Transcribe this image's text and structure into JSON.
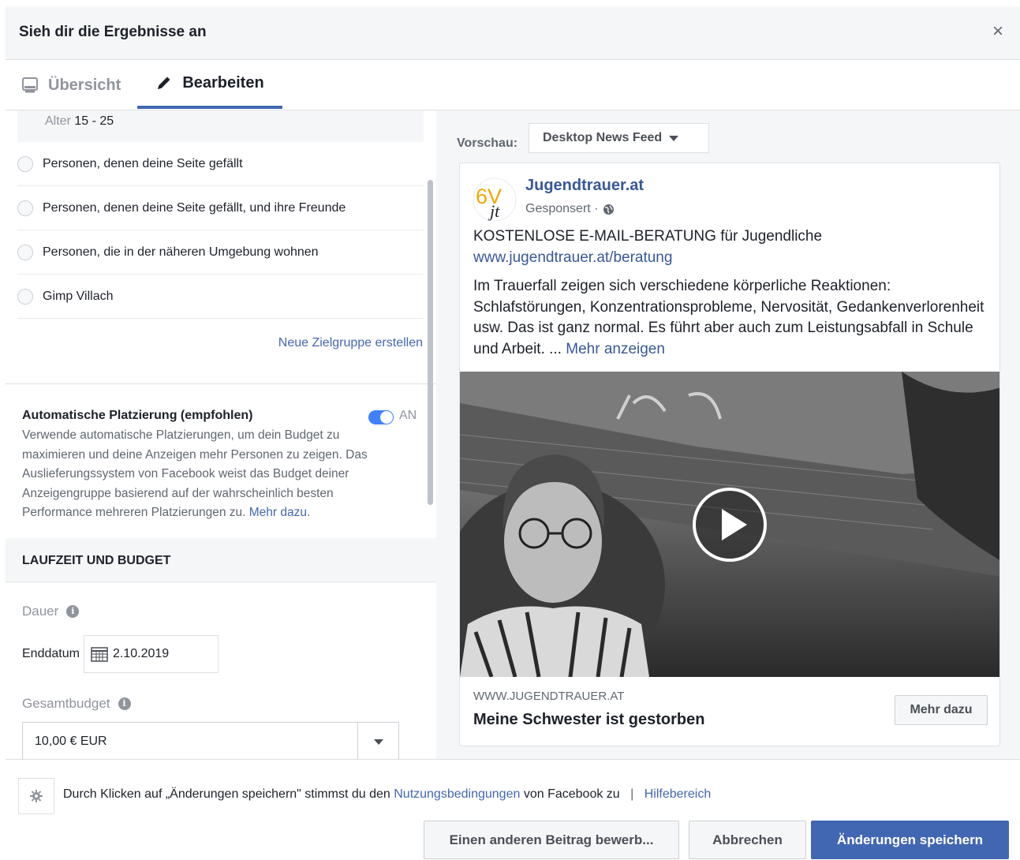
{
  "dialog": {
    "title": "Sieh dir die Ergebnisse an",
    "close_icon": "close-icon"
  },
  "tabs": [
    {
      "label": "Übersicht",
      "icon": "monitor-icon",
      "active": false
    },
    {
      "label": "Bearbeiten",
      "icon": "pencil-icon",
      "active": true
    }
  ],
  "audience": {
    "age_label": "Alter",
    "age_value": "15 - 25",
    "options": [
      "Personen, denen deine Seite gefällt",
      "Personen, denen deine Seite gefällt, und ihre Freunde",
      "Personen, die in der näheren Umgebung wohnen",
      "Gimp Villach"
    ],
    "new_audience_link": "Neue Zielgruppe erstellen"
  },
  "placement": {
    "title": "Automatische Platzierung (empfohlen)",
    "toggle_label": "AN",
    "toggle_on": true,
    "description": "Verwende automatische Platzierungen, um dein Budget zu maximieren und deine Anzeigen mehr Personen zu zeigen. Das Auslieferungssystem von Facebook weist das Budget deiner Anzeigengruppe basierend auf der wahrscheinlich besten Performance mehreren Platzierungen zu.",
    "more_link": "Mehr dazu"
  },
  "budget": {
    "section_title": "LAUFZEIT UND BUDGET",
    "duration_label": "Dauer",
    "end_date_label": "Enddatum",
    "end_date_value": "2.10.2019",
    "total_budget_label": "Gesamtbudget",
    "total_budget_value": "10,00 € EUR"
  },
  "preview": {
    "label": "Vorschau:",
    "placement_selected": "Desktop News Feed",
    "ad": {
      "logo_text": "6V",
      "logo_sub": "jt",
      "page_name": "Jugendtrauer.at",
      "sponsored": "Gesponsert ·",
      "headline": "KOSTENLOSE E-MAIL-BERATUNG für Jugendliche",
      "url": "www.jugendtrauer.at/beratung",
      "body": "Im Trauerfall zeigen sich verschiedene körperliche Reaktionen: Schlafstörungen, Konzentrationsprobleme, Nervosität, Gedankenverlorenheit usw. Das ist ganz normal. Es führt aber auch zum Leistungsabfall in Schule und Arbeit. ...",
      "see_more": "Mehr anzeigen",
      "link_domain": "WWW.JUGENDTRAUER.AT",
      "link_title": "Meine Schwester ist gestorben",
      "cta": "Mehr dazu"
    }
  },
  "footer": {
    "terms_prefix": "Durch Klicken auf „Änderungen speichern\" stimmst du den",
    "terms_link": "Nutzungsbedingungen",
    "terms_suffix": "von Facebook zu",
    "separator": "|",
    "help_link": "Hilfebereich",
    "btn_other": "Einen anderen Beitrag bewerb...",
    "btn_cancel": "Abbrechen",
    "btn_save": "Änderungen speichern"
  },
  "colors": {
    "accent": "#4267b2",
    "link": "#385898",
    "panel_bg": "#f5f6f7",
    "border": "#dddfe2"
  }
}
